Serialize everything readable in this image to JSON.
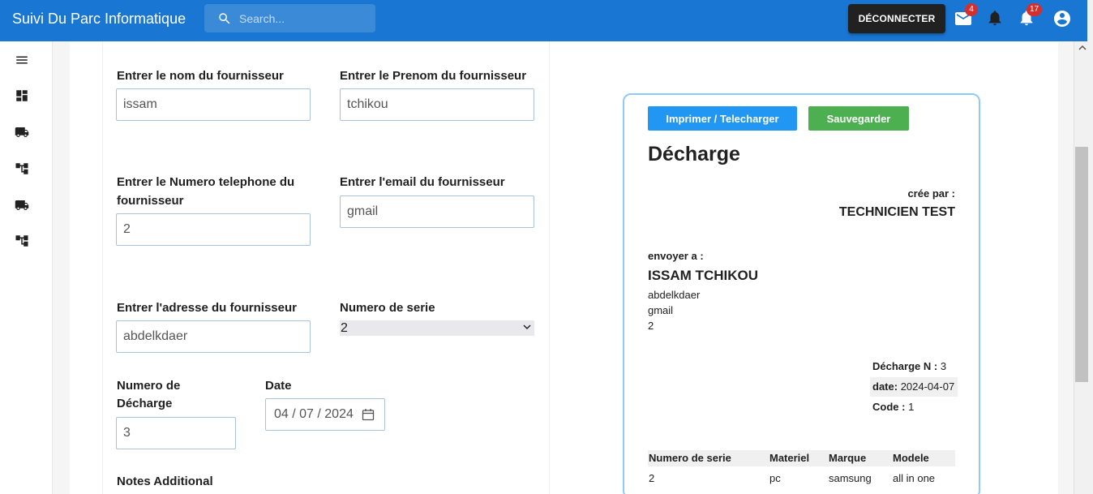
{
  "header": {
    "title": "Suivi Du Parc Informatique",
    "search_placeholder": "Search...",
    "logout_label": "DÉCONNECTER",
    "mail_badge": "4",
    "notif_badge": "17"
  },
  "sidebar": {
    "items": [
      {
        "icon": "menu-icon"
      },
      {
        "icon": "dashboard-icon"
      },
      {
        "icon": "truck-icon"
      },
      {
        "icon": "hierarchy-icon"
      },
      {
        "icon": "truck-icon"
      },
      {
        "icon": "hierarchy-icon"
      }
    ]
  },
  "form": {
    "nom_label": "Entrer le nom du fournisseur",
    "nom_value": "issam",
    "prenom_label": "Entrer le Prenom du fournisseur",
    "prenom_value": "tchikou",
    "tel_label_1": "Entrer le Numero telephone du",
    "tel_label_2": "fournisseur",
    "tel_value": "2",
    "email_label": "Entrer l'email du fournisseur",
    "email_value": "gmail",
    "adresse_label": "Entrer l'adresse du fournisseur",
    "adresse_value": "abdelkdaer",
    "serie_label": "Numero de serie",
    "serie_value": "2",
    "decharge_label_1": "Numero de",
    "decharge_label_2": "Décharge",
    "decharge_value": "3",
    "date_label": "Date",
    "date_value": "04 / 07 / 2024",
    "notes_label": "Notes Additional"
  },
  "invoice": {
    "print_label": "Imprimer / Telecharger",
    "save_label": "Sauvegarder",
    "title": "Décharge",
    "created_by_label": "crée par :",
    "created_by_value": "TECHNICIEN TEST",
    "sent_to_label": "envoyer a :",
    "recipient_name": "ISSAM TCHIKOU",
    "recipient_address": "abdelkdaer",
    "recipient_email": "gmail",
    "recipient_phone": "2",
    "number_label": "Décharge N :",
    "number_value": "3",
    "date_label": "date:",
    "date_value": "2024-04-07",
    "code_label": "Code :",
    "code_value": "1",
    "table": {
      "headers": [
        "Numero de serie",
        "Materiel",
        "Marque",
        "Modele"
      ],
      "rows": [
        [
          "2",
          "pc",
          "samsung",
          "all in one"
        ]
      ]
    }
  },
  "colors": {
    "appbar": "#1976d2",
    "print_button": "#2196f3",
    "save_button": "#4caf50",
    "badge": "#d32f2f",
    "card_border": "#90caf9"
  }
}
